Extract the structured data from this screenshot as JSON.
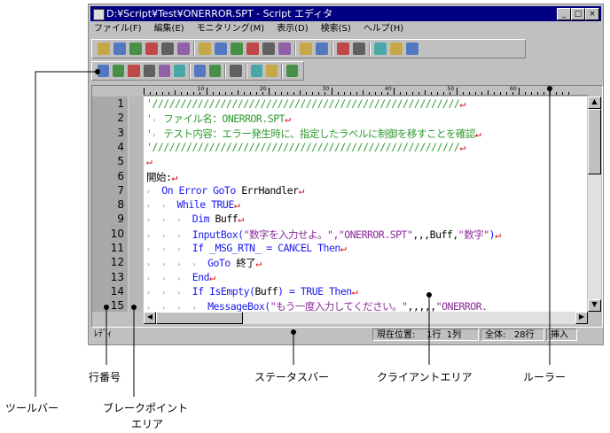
{
  "window": {
    "title": "D:¥Script¥Test¥ONERROR.SPT - Script エディタ",
    "min": "_",
    "max": "□",
    "close": "×"
  },
  "menu": [
    "ファイル(F)",
    "編集(E)",
    "モニタリング(M)",
    "表示(D)",
    "検索(S)",
    "ヘルプ(H)"
  ],
  "toolbar1": [
    "new",
    "open",
    "save",
    "print",
    "book",
    "help",
    "|",
    "undo",
    "redo",
    "cut",
    "copy",
    "paste",
    "select-all",
    "|",
    "breakpoint-set",
    "breakpoint-clear",
    "|",
    "compile",
    "edit-config",
    "|",
    "find",
    "find-prev",
    "find-next"
  ],
  "toolbar2": [
    "run-check",
    "run",
    "stop",
    "step",
    "step-over",
    "step-all",
    "|",
    "watch",
    "watch-clear",
    "|",
    "debug-ref",
    "|",
    "window1",
    "window2",
    "|",
    "exit-debug"
  ],
  "ruler": {
    "ticks": [
      "10",
      "20",
      "30",
      "40",
      "50",
      "60"
    ]
  },
  "lines": [
    [
      {
        "t": "'//////////////////////////////////////////////////////",
        "c": "comment"
      }
    ],
    [
      {
        "t": "'",
        "c": "comment"
      },
      {
        "t": "›  ",
        "c": "tab"
      },
      {
        "t": "ファイル名：ONERROR.SPT",
        "c": "comment"
      }
    ],
    [
      {
        "t": "'",
        "c": "comment"
      },
      {
        "t": "›  ",
        "c": "tab"
      },
      {
        "t": "テスト内容：エラー発生時に、指定したラベルに制御を移すことを確認",
        "c": "comment"
      }
    ],
    [
      {
        "t": "'//////////////////////////////////////////////////////",
        "c": "comment"
      }
    ],
    [],
    [
      {
        "t": "開始:",
        "c": "plain"
      }
    ],
    [
      {
        "t": "›   ",
        "c": "tab"
      },
      {
        "t": "On Error GoTo ",
        "c": "kw"
      },
      {
        "t": "ErrHandler",
        "c": "plain"
      }
    ],
    [
      {
        "t": "›   ›   ",
        "c": "tab"
      },
      {
        "t": "While TRUE",
        "c": "kw"
      }
    ],
    [
      {
        "t": "›   ›   ›   ",
        "c": "tab"
      },
      {
        "t": "Dim ",
        "c": "kw"
      },
      {
        "t": "Buff",
        "c": "plain"
      }
    ],
    [
      {
        "t": "›   ›   ›   ",
        "c": "tab"
      },
      {
        "t": "InputBox(",
        "c": "kw"
      },
      {
        "t": "\"数字を入力せよ。\",\"ONERROR.SPT\"",
        "c": "str"
      },
      {
        "t": ",,,Buff,",
        "c": "plain"
      },
      {
        "t": "\"数字\"",
        "c": "str"
      },
      {
        "t": ")",
        "c": "kw"
      }
    ],
    [
      {
        "t": "›   ›   ›   ",
        "c": "tab"
      },
      {
        "t": "If _MSG_RTN_ = CANCEL Then",
        "c": "kw"
      }
    ],
    [
      {
        "t": "›   ›   ›   ›   ",
        "c": "tab"
      },
      {
        "t": "GoTo ",
        "c": "kw"
      },
      {
        "t": "終了",
        "c": "plain"
      }
    ],
    [
      {
        "t": "›   ›   ›   ",
        "c": "tab"
      },
      {
        "t": "End",
        "c": "kw"
      }
    ],
    [
      {
        "t": "›   ›   ›   ",
        "c": "tab"
      },
      {
        "t": "If IsEmpty(",
        "c": "kw"
      },
      {
        "t": "Buff",
        "c": "plain"
      },
      {
        "t": ") = TRUE Then",
        "c": "kw"
      }
    ],
    [
      {
        "t": "›   ›   ›   ›   ",
        "c": "tab"
      },
      {
        "t": "MessageBox(",
        "c": "kw"
      },
      {
        "t": "\"もう一度入力してください。\"",
        "c": "str"
      },
      {
        "t": ",,,,,",
        "c": "plain"
      },
      {
        "t": "\"ONERROR.",
        "c": "str"
      }
    ]
  ],
  "line_has_return": [
    true,
    true,
    true,
    true,
    true,
    true,
    true,
    true,
    true,
    true,
    true,
    true,
    true,
    true,
    false
  ],
  "status": {
    "ready": "ﾚﾃﾞｨ",
    "position": "現在位置:    1行  1列",
    "total": "全体:   28行",
    "mode": "挿入"
  },
  "callouts": {
    "toolbar": "ツールバー",
    "line_numbers": "行番号",
    "breakpoint_area_1": "ブレークポイント",
    "breakpoint_area_2": "エリア",
    "status_bar": "ステータスバー",
    "client_area": "クライアントエリア",
    "ruler": "ルーラー"
  },
  "colors": {
    "titlebar": "#000080",
    "comment": "#2e9a2e",
    "keyword": "#1a1af0",
    "string": "#8a2a9a",
    "return_mark": "#dd0000"
  }
}
